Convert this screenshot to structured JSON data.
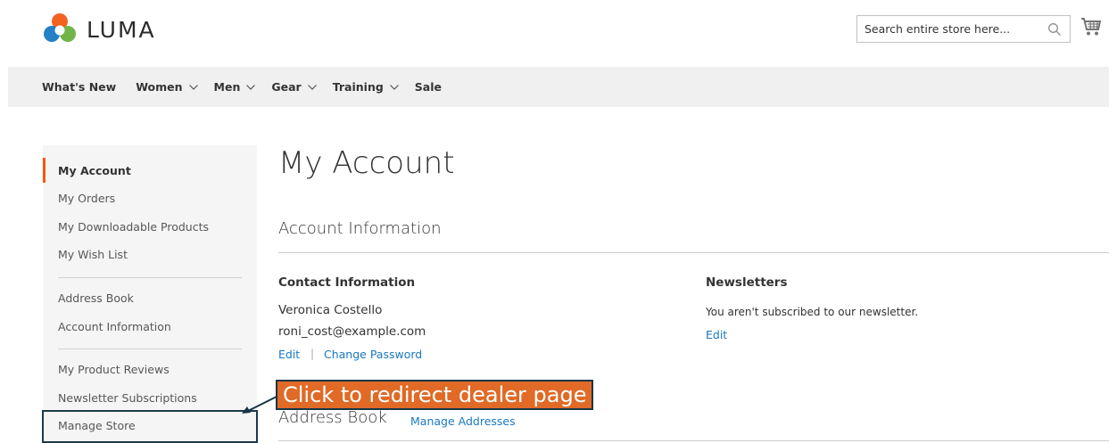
{
  "header": {
    "logo_text": "LUMA",
    "search_placeholder": "Search entire store here...",
    "brand_colors": {
      "orange": "#f26322",
      "blue": "#1979c3",
      "green": "#6ab040",
      "accent": "#ff5501"
    }
  },
  "nav": {
    "items": [
      {
        "label": "What's New",
        "has_dropdown": false
      },
      {
        "label": "Women",
        "has_dropdown": true
      },
      {
        "label": "Men",
        "has_dropdown": true
      },
      {
        "label": "Gear",
        "has_dropdown": true
      },
      {
        "label": "Training",
        "has_dropdown": true
      },
      {
        "label": "Sale",
        "has_dropdown": false
      }
    ]
  },
  "sidebar": {
    "items": [
      {
        "label": "My Account",
        "current": true
      },
      {
        "label": "My Orders"
      },
      {
        "label": "My Downloadable Products"
      },
      {
        "label": "My Wish List"
      },
      {
        "label": "Address Book"
      },
      {
        "label": "Account Information"
      },
      {
        "label": "My Product Reviews"
      },
      {
        "label": "Newsletter Subscriptions"
      },
      {
        "label": "Manage Store"
      }
    ]
  },
  "main": {
    "page_title": "My Account",
    "account_info": {
      "title": "Account Information",
      "contact": {
        "title": "Contact Information",
        "name": "Veronica Costello",
        "email": "roni_cost@example.com",
        "edit_label": "Edit",
        "separator": "|",
        "change_password_label": "Change Password"
      },
      "newsletters": {
        "title": "Newsletters",
        "text": "You aren't subscribed to our newsletter.",
        "edit_label": "Edit"
      }
    },
    "address_book": {
      "title": "Address Book",
      "manage_label": "Manage Addresses"
    }
  },
  "annotation": {
    "callout_text": "Click to redirect dealer page"
  }
}
